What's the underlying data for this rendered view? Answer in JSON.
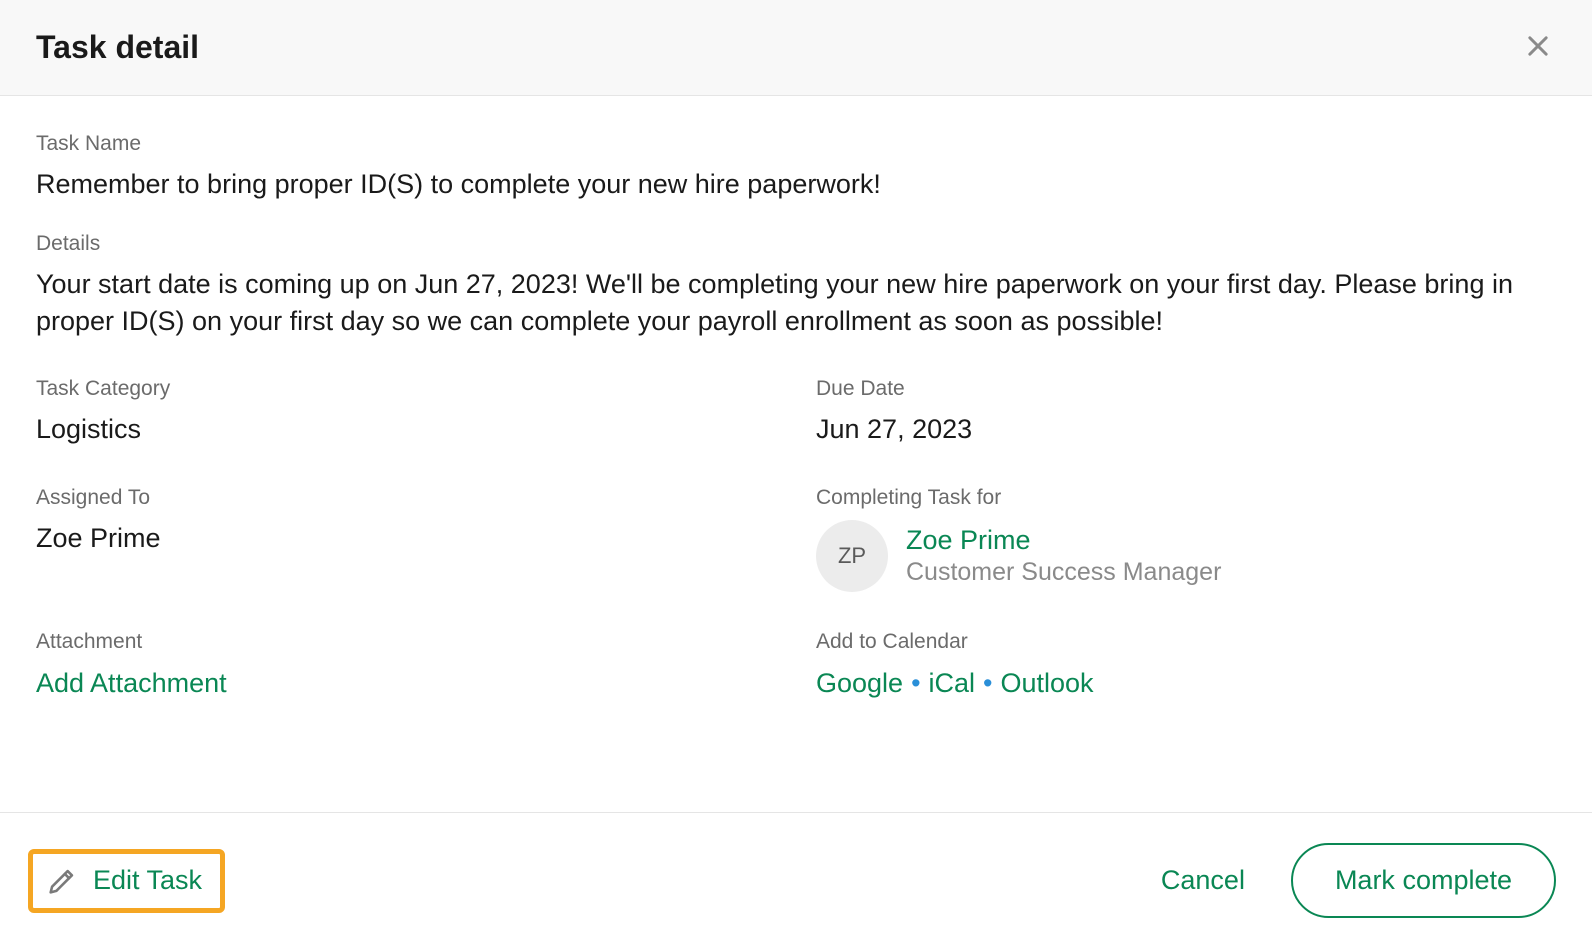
{
  "header": {
    "title": "Task detail"
  },
  "fields": {
    "task_name_label": "Task Name",
    "task_name_value": "Remember to bring proper ID(S) to complete your new hire paperwork!",
    "details_label": "Details",
    "details_value": "Your start date is coming up on Jun 27, 2023! We'll be completing your new hire paperwork on your first day. Please bring in proper ID(S) on your first day so we can complete your payroll enrollment as soon as possible!",
    "task_category_label": "Task Category",
    "task_category_value": "Logistics",
    "due_date_label": "Due Date",
    "due_date_value": "Jun 27, 2023",
    "assigned_to_label": "Assigned To",
    "assigned_to_value": "Zoe Prime",
    "completing_for_label": "Completing Task for",
    "completing_for_user": {
      "initials": "ZP",
      "name": "Zoe Prime",
      "role": "Customer Success Manager"
    },
    "attachment_label": "Attachment",
    "add_attachment_label": "Add Attachment",
    "add_to_calendar_label": "Add to Calendar",
    "calendar_links": {
      "google": "Google",
      "ical": "iCal",
      "outlook": "Outlook"
    }
  },
  "footer": {
    "edit_task_label": "Edit Task",
    "cancel_label": "Cancel",
    "mark_complete_label": "Mark complete"
  }
}
